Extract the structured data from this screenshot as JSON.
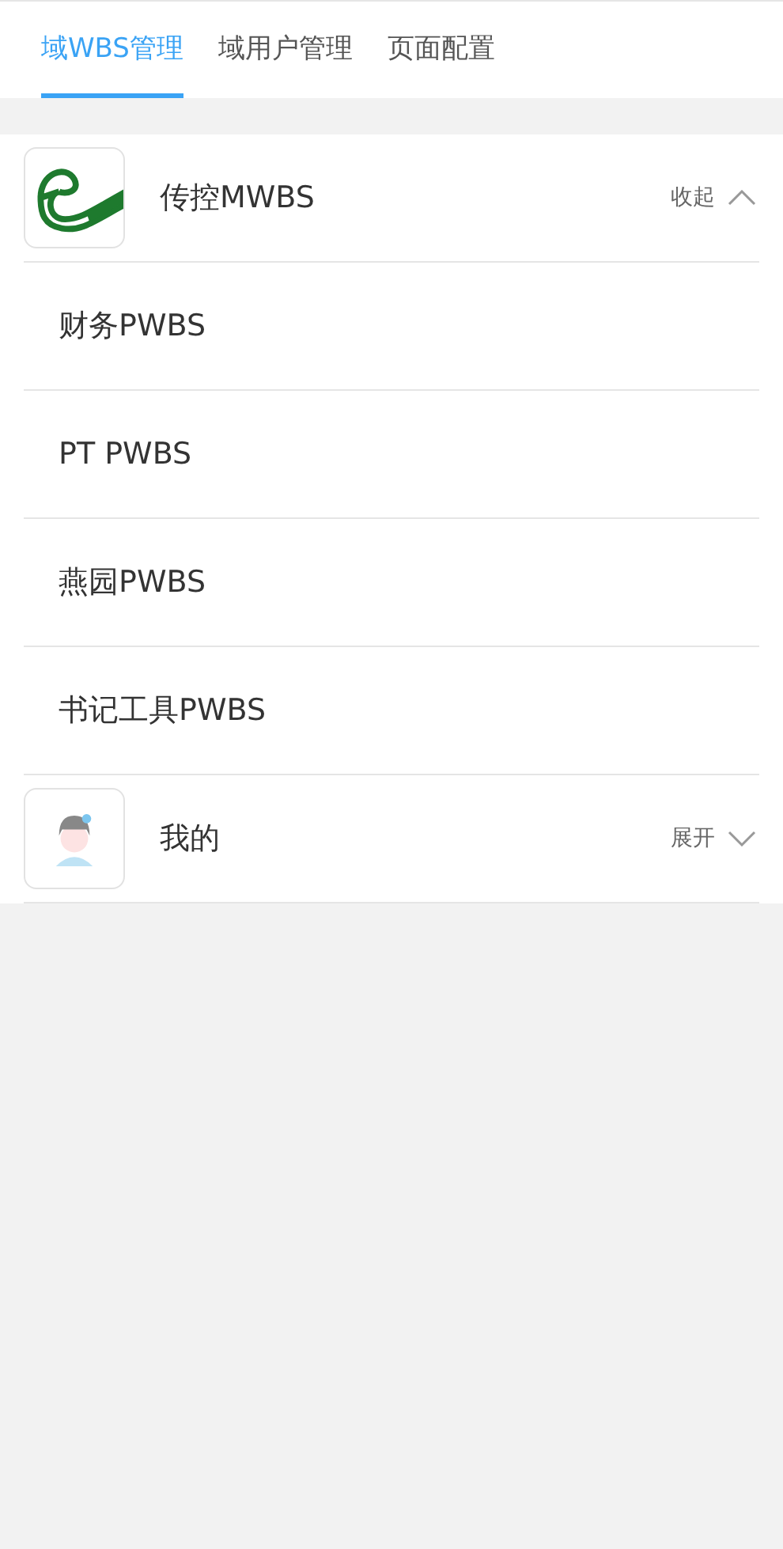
{
  "tabs": [
    {
      "label": "域WBS管理",
      "selected": true
    },
    {
      "label": "域用户管理",
      "selected": false
    },
    {
      "label": "页面配置",
      "selected": false
    }
  ],
  "groups": [
    {
      "kind": "logo",
      "title": "传控MWBS",
      "toggle_label": "收起",
      "expanded": true,
      "items": [
        "财务PWBS",
        "PT PWBS",
        "燕园PWBS",
        "书记工具PWBS"
      ]
    },
    {
      "kind": "avatar",
      "title": "我的",
      "toggle_label": "展开",
      "expanded": false
    }
  ]
}
